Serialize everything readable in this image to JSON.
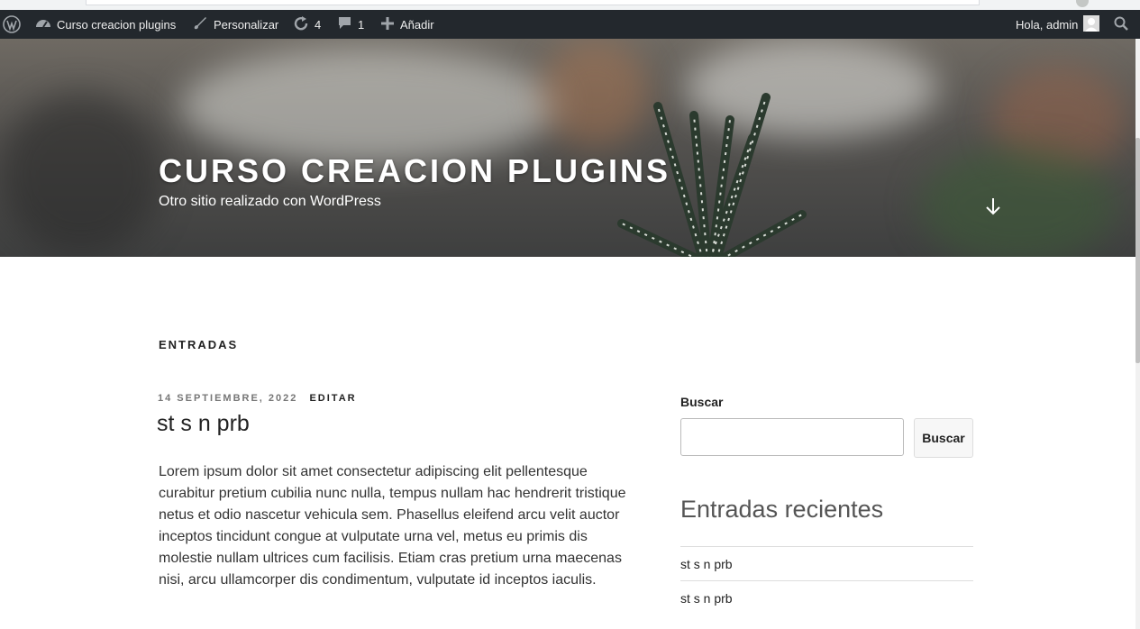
{
  "colors": {
    "admin_bar_bg": "#23282d",
    "admin_bar_text": "#eeeeee",
    "hero_overlay": "#4a4a4a",
    "text_dark": "#222222",
    "text_meta": "#767676"
  },
  "admin_bar": {
    "logo_icon": "wordpress-icon",
    "site_name": "Curso creacion plugins",
    "site_icon": "dashboard-icon",
    "customize_label": "Personalizar",
    "customize_icon": "brush-icon",
    "updates_count": "4",
    "updates_icon": "updates-icon",
    "comments_count": "1",
    "comments_icon": "comment-icon",
    "new_label": "Añadir",
    "new_icon": "plus-icon",
    "greeting": "Hola, admin",
    "avatar_icon": "avatar-icon",
    "search_icon": "search-icon"
  },
  "header": {
    "site_title": "CURSO CREACION PLUGINS",
    "site_description": "Otro sitio realizado con WordPress",
    "scroll_icon": "arrow-down-icon"
  },
  "main": {
    "section_title": "ENTRADAS",
    "post": {
      "date": "14 SEPTIEMBRE, 2022",
      "edit_label": "EDITAR",
      "title": "st s n prb",
      "body": "Lorem ipsum dolor sit amet consectetur adipiscing elit pellentesque curabitur pretium cubilia nunc nulla, tempus nullam hac hendrerit tristique netus et odio nascetur vehicula sem. Phasellus eleifend arcu velit auctor inceptos tincidunt congue at vulputate urna vel, metus eu primis dis molestie nullam ultrices cum facilisis. Etiam cras pretium urna maecenas nisi, arcu ullamcorper dis condimentum, vulputate id inceptos iaculis."
    }
  },
  "sidebar": {
    "search_label": "Buscar",
    "search_value": "",
    "search_button": "Buscar",
    "recent_title": "Entradas recientes",
    "recent_posts": [
      "st s n prb",
      "st s n prb"
    ]
  }
}
